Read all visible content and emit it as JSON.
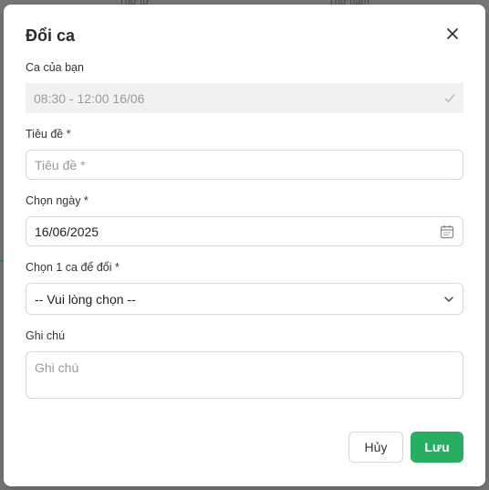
{
  "background": {
    "col_a": "Thứ tư",
    "col_b": "Thứ năm"
  },
  "modal": {
    "title": "Đổi ca",
    "close_icon": "close-icon"
  },
  "fields": {
    "current_shift": {
      "label": "Ca của bạn",
      "value": "08:30 - 12:00 16/06",
      "icon": "check-icon"
    },
    "title": {
      "label": "Tiêu đề *",
      "placeholder": "Tiêu đề *"
    },
    "date": {
      "label": "Chọn ngày *",
      "value": "16/06/2025",
      "icon": "calendar-icon"
    },
    "swap_shift": {
      "label": "Chọn 1 ca để đổi *",
      "selected": "-- Vui lòng chọn --",
      "icon": "chevron-down-icon"
    },
    "note": {
      "label": "Ghi chú",
      "placeholder": "Ghi chú"
    }
  },
  "actions": {
    "cancel_label": "Hủy",
    "save_label": "Lưu"
  },
  "colors": {
    "primary": "#27ae60",
    "readonly_bg": "#f1f1f1"
  }
}
